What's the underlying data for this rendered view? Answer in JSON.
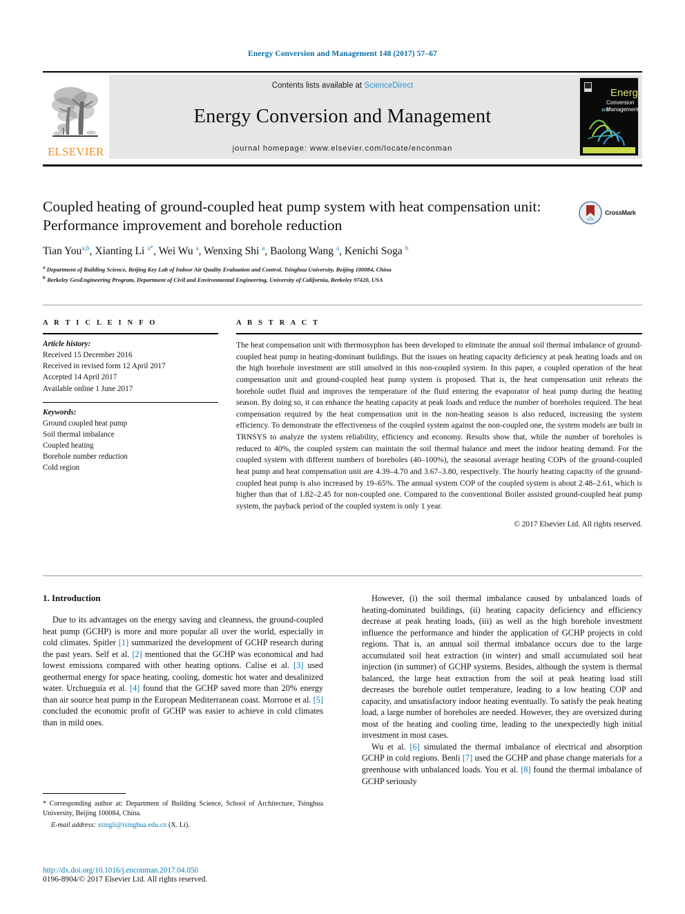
{
  "running_head": "Energy Conversion and Management 148 (2017) 57–67",
  "masthead": {
    "publisher_name": "ELSEVIER",
    "contents_prefix": "Contents lists available at ",
    "contents_link": "ScienceDirect",
    "journal_title": "Energy Conversion and Management",
    "homepage_line": "journal homepage: www.elsevier.com/locate/enconman",
    "cover_title_line1": "Energy",
    "cover_title_line2": "Conversion",
    "cover_title_line3": "Management",
    "cover_title_and": "and"
  },
  "article": {
    "title": "Coupled heating of ground-coupled heat pump system with heat compensation unit: Performance improvement and borehole reduction",
    "crossmark_label": "CrossMark",
    "authors": [
      {
        "name": "Tian You",
        "sup": "a,b"
      },
      {
        "name": "Xianting Li",
        "sup": "a*"
      },
      {
        "name": "Wei Wu",
        "sup": "a"
      },
      {
        "name": "Wenxing Shi",
        "sup": "a"
      },
      {
        "name": "Baolong Wang",
        "sup": "a"
      },
      {
        "name": "Kenichi Soga",
        "sup": "b"
      }
    ],
    "affiliations": [
      {
        "marker": "a",
        "text": "Department of Building Science, Beijing Key Lab of Indoor Air Quality Evaluation and Control, Tsinghua University, Beijing 100084, China"
      },
      {
        "marker": "b",
        "text": "Berkeley GeoEngineering Program, Department of Civil and Environmental Engineering, University of California, Berkeley 97420, USA"
      }
    ]
  },
  "article_info": {
    "heading": "A R T I C L E  I N F O",
    "history_label": "Article history:",
    "history": [
      "Received 15 December 2016",
      "Received in revised form 12 April 2017",
      "Accepted 14 April 2017",
      "Available online 1 June 2017"
    ],
    "keywords_label": "Keywords:",
    "keywords": [
      "Ground coupled heat pump",
      "Soil thermal imbalance",
      "Coupled heating",
      "Borehole number reduction",
      "Cold region"
    ]
  },
  "abstract": {
    "heading": "A B S T R A C T",
    "text": "The heat compensation unit with thermosyphon has been developed to eliminate the annual soil thermal imbalance of ground-coupled heat pump in heating-dominant buildings. But the issues on heating capacity deficiency at peak heating loads and on the high borehole investment are still unsolved in this non-coupled system. In this paper, a coupled operation of the heat compensation unit and ground-coupled heat pump system is proposed. That is, the heat compensation unit reheats the borehole outlet fluid and improves the temperature of the fluid entering the evaporator of heat pump during the heating season. By doing so, it can enhance the heating capacity at peak loads and reduce the number of boreholes required. The heat compensation required by the heat compensation unit in the non-heating season is also reduced, increasing the system efficiency. To demonstrate the effectiveness of the coupled system against the non-coupled one, the system models are built in TRNSYS to analyze the system reliability, efficiency and economy. Results show that, while the number of boreholes is reduced to 40%, the coupled system can maintain the soil thermal balance and meet the indoor heating demand. For the coupled system with different numbers of boreholes (40–100%), the seasonal average heating COPs of the ground-coupled heat pump and heat compensation unit are 4.39–4.70 and 3.67–3.80, respectively. The hourly heating capacity of the ground-coupled heat pump is also increased by 19–65%. The annual system COP of the coupled system is about 2.48–2.61, which is higher than that of 1.82–2.45 for non-coupled one. Compared to the conventional Boiler assisted ground-coupled heat pump system, the payback period of the coupled system is only 1 year.",
    "copyright": "© 2017 Elsevier Ltd. All rights reserved."
  },
  "introduction": {
    "heading": "1. Introduction",
    "left_paragraph_1_parts": [
      "Due to its advantages on the energy saving and cleanness, the ground-coupled heat pump (GCHP) is more and more popular all over the world, especially in cold climates. Spitler ",
      "[1]",
      " summarized the development of GCHP research during the past years. Self et al. ",
      "[2]",
      " mentioned that the GCHP was economical and had lowest emissions compared with other heating options. Calise et al. ",
      "[3]",
      " used geothermal energy for space heating, cooling, domestic hot water and desalinized water. Urchueguía et al. ",
      "[4]",
      " found that the GCHP saved more than 20% energy than air source heat pump in the European Mediterranean coast. Morrone et al. ",
      "[5]",
      " concluded the economic profit of GCHP was easier to achieve in cold climates than in mild ones."
    ],
    "right_paragraph_1": "However, (i) the soil thermal imbalance caused by unbalanced loads of heating-dominated buildings, (ii) heating capacity deficiency and efficiency decrease at peak heating loads, (iii) as well as the high borehole investment influence the performance and hinder the application of GCHP projects in cold regions. That is, an annual soil thermal imbalance occurs due to the large accumulated soil heat extraction (in winter) and small accumulated soil heat injection (in summer) of GCHP systems. Besides, although the system is thermal balanced, the large heat extraction from the soil at peak heating load still decreases the borehole outlet temperature, leading to a low heating COP and capacity, and unsatisfactory indoor heating eventually. To satisfy the peak heating load, a large number of boreholes are needed. However, they are oversized during most of the heating and cooling time, leading to the unexpectedly high initial investment in most cases.",
    "right_paragraph_2_parts": [
      "Wu et al. ",
      "[6]",
      " simulated the thermal imbalance of electrical and absorption GCHP in cold regions. Benli ",
      "[7]",
      " used the GCHP and phase change materials for a greenhouse with unbalanced loads. You et al. ",
      "[8]",
      " found the thermal imbalance of GCHP seriously"
    ]
  },
  "footnote": {
    "star": "*",
    "corresponding": " Corresponding author at: Department of Building Science, School of Architecture, Tsinghua University, Beijing 100084, China.",
    "email_label": "E-mail address:",
    "email": "xtingli@tsinghua.edu.cn",
    "email_suffix": " (X. Li)."
  },
  "colophon": {
    "doi": "http://dx.doi.org/10.1016/j.enconman.2017.04.050",
    "issn_line": "0196-8904/© 2017 Elsevier Ltd. All rights reserved."
  },
  "colors": {
    "link_blue": "#0b7cb5",
    "header_blue": "#0b6ca3",
    "sciencedirect_blue": "#2a93d5",
    "elsevier_orange": "#f08a1d",
    "masthead_gray": "#e6e6e6"
  }
}
